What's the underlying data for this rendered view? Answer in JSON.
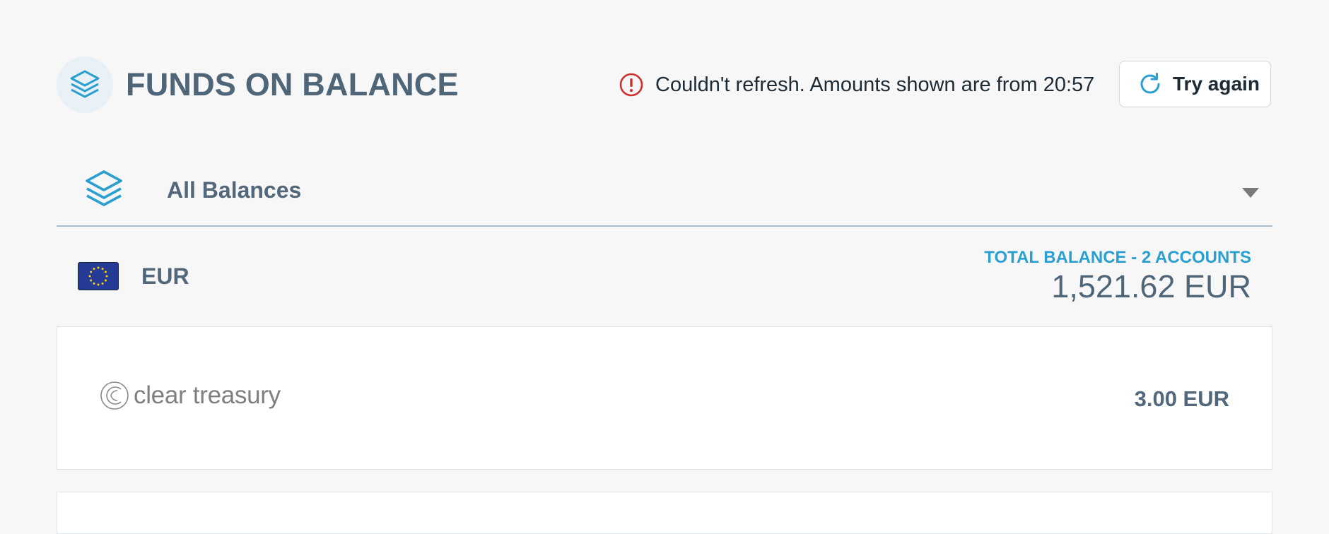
{
  "header": {
    "title": "FUNDS ON BALANCE",
    "icon": "layers-icon",
    "alert": {
      "icon": "exclamation-circle-icon",
      "text": "Couldn't refresh. Amounts shown are from 20:57",
      "color": "#d32f2f"
    },
    "retry": {
      "icon": "refresh-icon",
      "label": "Try again"
    }
  },
  "balance_selector": {
    "icon": "layers-icon",
    "label": "All Balances",
    "dropdown_icon": "caret-down-icon"
  },
  "currency_group": {
    "flag": "eu-flag",
    "code": "EUR",
    "total_label": "TOTAL BALANCE - 2 ACCOUNTS",
    "total_amount": "1,521.62 EUR"
  },
  "accounts": [
    {
      "provider": "clear treasury",
      "amount": "3.00 EUR"
    }
  ],
  "colors": {
    "accent": "#2a9fd0",
    "title": "#4f6679",
    "background": "#f7f7f7"
  }
}
